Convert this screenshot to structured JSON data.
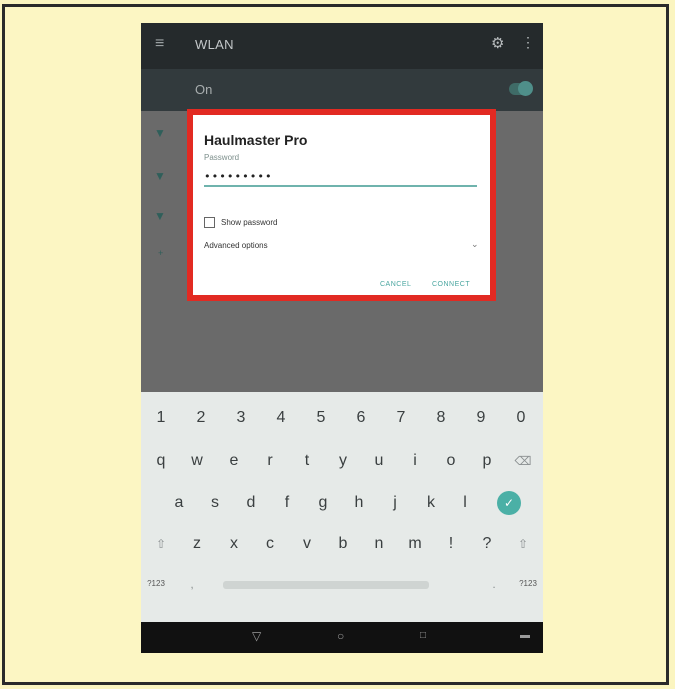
{
  "appbar": {
    "title": "WLAN",
    "menu_icon": "≡",
    "settings_icon": "⚙",
    "more_icon": "⋮"
  },
  "onbar": {
    "label": "On"
  },
  "dialog": {
    "network_name": "Haulmaster Pro",
    "password_label": "Password",
    "password_value": "•••••••••",
    "show_password_label": "Show password",
    "advanced_options_label": "Advanced options",
    "cancel_label": "CANCEL",
    "connect_label": "CONNECT"
  },
  "keyboard": {
    "row_numbers": [
      "1",
      "2",
      "3",
      "4",
      "5",
      "6",
      "7",
      "8",
      "9",
      "0"
    ],
    "row_q": [
      "q",
      "w",
      "e",
      "r",
      "t",
      "y",
      "u",
      "i",
      "o",
      "p"
    ],
    "row_a": [
      "a",
      "s",
      "d",
      "f",
      "g",
      "h",
      "j",
      "k",
      "l"
    ],
    "row_z": [
      "z",
      "x",
      "c",
      "v",
      "b",
      "n",
      "m",
      "!",
      "?"
    ],
    "symbols_label": "?123",
    "comma": ",",
    "period": "."
  },
  "colors": {
    "accent": "#4bb0a6",
    "highlight_border": "#e22a22",
    "background": "#fbf5c0"
  }
}
